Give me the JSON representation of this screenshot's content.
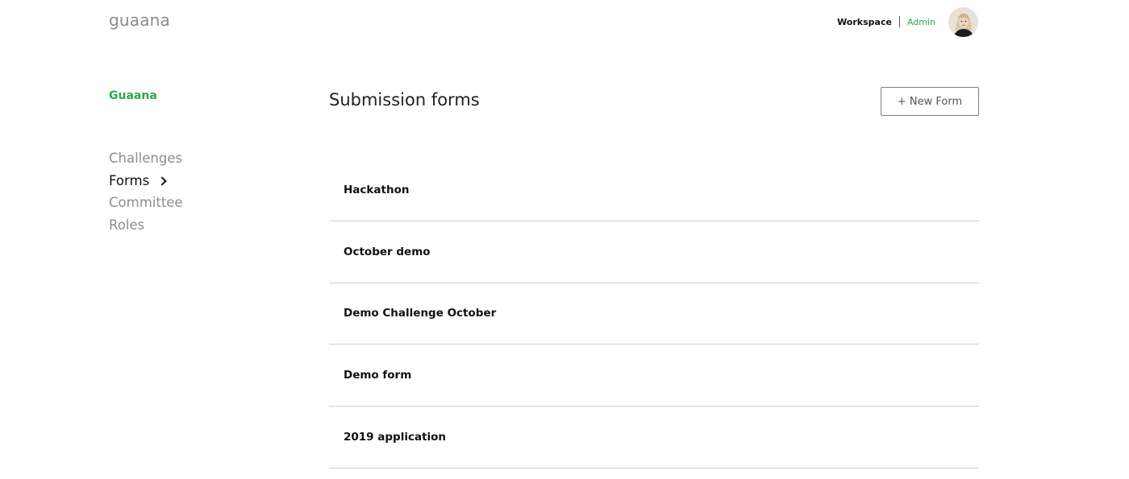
{
  "header": {
    "logo": "guaana",
    "workspace_label": "Workspace",
    "admin_label": "Admin"
  },
  "sidebar": {
    "title": "Guaana",
    "items": [
      {
        "label": "Challenges",
        "active": false
      },
      {
        "label": "Forms",
        "active": true
      },
      {
        "label": "Committee",
        "active": false
      },
      {
        "label": "Roles",
        "active": false
      }
    ]
  },
  "main": {
    "title": "Submission forms",
    "new_form_label": "+ New Form",
    "forms": [
      {
        "name": "Hackathon"
      },
      {
        "name": "October demo"
      },
      {
        "name": "Demo Challenge October"
      },
      {
        "name": "Demo form"
      },
      {
        "name": "2019 application"
      }
    ]
  },
  "colors": {
    "accent": "#2ea84a",
    "muted_text": "#8d8d8d",
    "divider": "#cfcfcf"
  }
}
